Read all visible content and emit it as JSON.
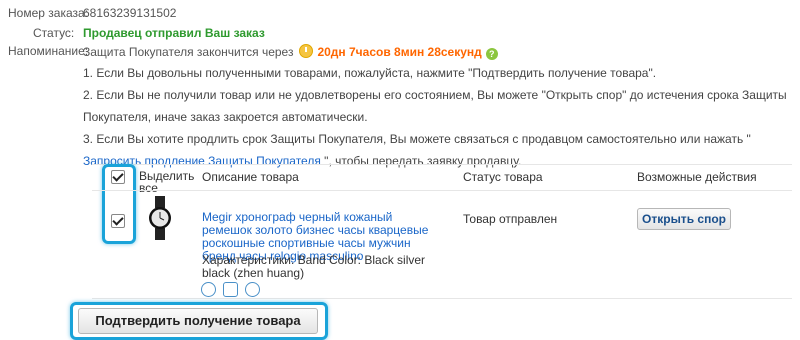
{
  "order": {
    "number_label": "Номер заказа:",
    "number_value": "68163239131502",
    "status_label": "Статус:",
    "status_value": "Продавец отправил Ваш заказ",
    "reminder_label": "Напоминание:",
    "reminder_text": "Защита Покупателя закончится через",
    "countdown": "20дн 7часов 8мин 28секунд",
    "help_icon": "?"
  },
  "notes": {
    "n1": "1. Если Вы довольны полученными товарами, пожалуйста, нажмите \"Подтвердить получение товара\".",
    "n2": "2. Если Вы не получили товар или не удовлетворены его состоянием, Вы можете \"Открыть спор\" до истечения срока Защиты Покупателя, иначе заказ закроется автоматически.",
    "n3_pre": "3. Если Вы хотите продлить срок Защиты Покупателя, Вы можете связаться с продавцом самостоятельно или нажать \" ",
    "n3_link": "Запросить продление Защиты Покупателя",
    "n3_post": " \", чтобы передать заявку продавцу."
  },
  "table": {
    "headers": {
      "select_all": "Выделить все",
      "description": "Описание товара",
      "status": "Статус товара",
      "actions": "Возможные действия"
    },
    "items": [
      {
        "title": "Megir хронограф черный кожаный ремешок золото бизнес часы кварцевые роскошные спортивные часы мужчин бренд часы relogio masculino",
        "specs": "Характеристики: Band Color: Black silver black (zhen huang)",
        "status": "Товар отправлен",
        "action_label": "Открыть спор"
      }
    ]
  },
  "footer": {
    "confirm_label": "Подтвердить получение товара"
  },
  "colors": {
    "status_green": "#2f9a2f",
    "countdown_orange": "#ff6600",
    "link_blue": "#1a66c8",
    "highlight_blue": "#1aa3d9"
  },
  "icons": [
    "clock-icon",
    "help-icon",
    "watch-thumbnail",
    "alarm-icon",
    "calendar-icon",
    "refresh-icon"
  ]
}
